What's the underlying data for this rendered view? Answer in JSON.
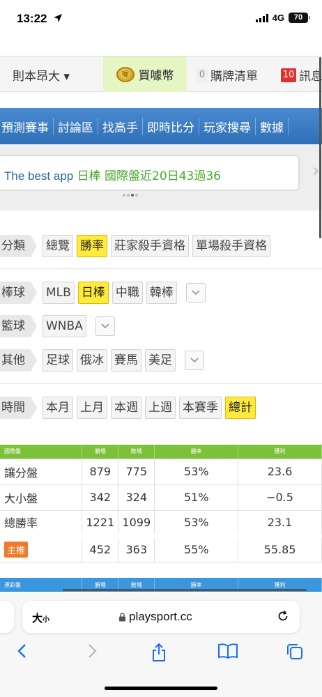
{
  "status": {
    "time": "13:22",
    "network": "4G",
    "battery": "70"
  },
  "userbar": {
    "username": "則本昂大 ▾",
    "buy_coin_label": "買噱幣",
    "coin_glyph": "噱",
    "cart_count": "0",
    "cart_label": "購牌清單",
    "msg_count": "10",
    "msg_label": "訊息"
  },
  "nav": [
    "預測賽事",
    "討論區",
    "找高手",
    "即時比分",
    "玩家搜尋",
    "數據"
  ],
  "ad": {
    "en": "The best app",
    "cn": "日棒 國際盤近20日43過36"
  },
  "filters": {
    "category": {
      "label": "分類",
      "chips": [
        "總覽",
        "勝率",
        "莊家殺手資格",
        "單場殺手資格"
      ],
      "selected": 1
    },
    "baseball": {
      "label": "棒球",
      "chips": [
        "MLB",
        "日棒",
        "中職",
        "韓棒"
      ],
      "selected": 1
    },
    "basketball": {
      "label": "籃球",
      "chips": [
        "WNBA"
      ]
    },
    "other": {
      "label": "其他",
      "chips": [
        "足球",
        "俄冰",
        "賽馬",
        "美足"
      ]
    },
    "time": {
      "label": "時間",
      "chips": [
        "本月",
        "上月",
        "本週",
        "上週",
        "本賽季",
        "總計"
      ],
      "selected": 5
    }
  },
  "table1": {
    "headers": [
      "國際盤",
      "勝場",
      "敗場",
      "勝率",
      "獲利"
    ],
    "rows": [
      [
        "讓分盤",
        "879",
        "775",
        "53%",
        "23.6"
      ],
      [
        "大小盤",
        "342",
        "324",
        "51%",
        "−0.5"
      ],
      [
        "總勝率",
        "1221",
        "1099",
        "53%",
        "23.1"
      ]
    ],
    "featured": {
      "tag": "主推",
      "values": [
        "452",
        "363",
        "55%",
        "55.85"
      ]
    }
  },
  "table2": {
    "headers": [
      "運彩盤",
      "勝場",
      "敗場",
      "勝率",
      "獲利"
    ]
  },
  "safari": {
    "text_size": "大",
    "text_size_small": "小",
    "url": "playsport.cc"
  },
  "colors": {
    "nav_blue": "#2e6fb7",
    "table_green": "#7cc13a",
    "table_blue": "#3b97dd",
    "selected_yellow": "#ffeb3b",
    "ad_green": "#4caa2c",
    "ad_blue": "#2a63a6"
  }
}
